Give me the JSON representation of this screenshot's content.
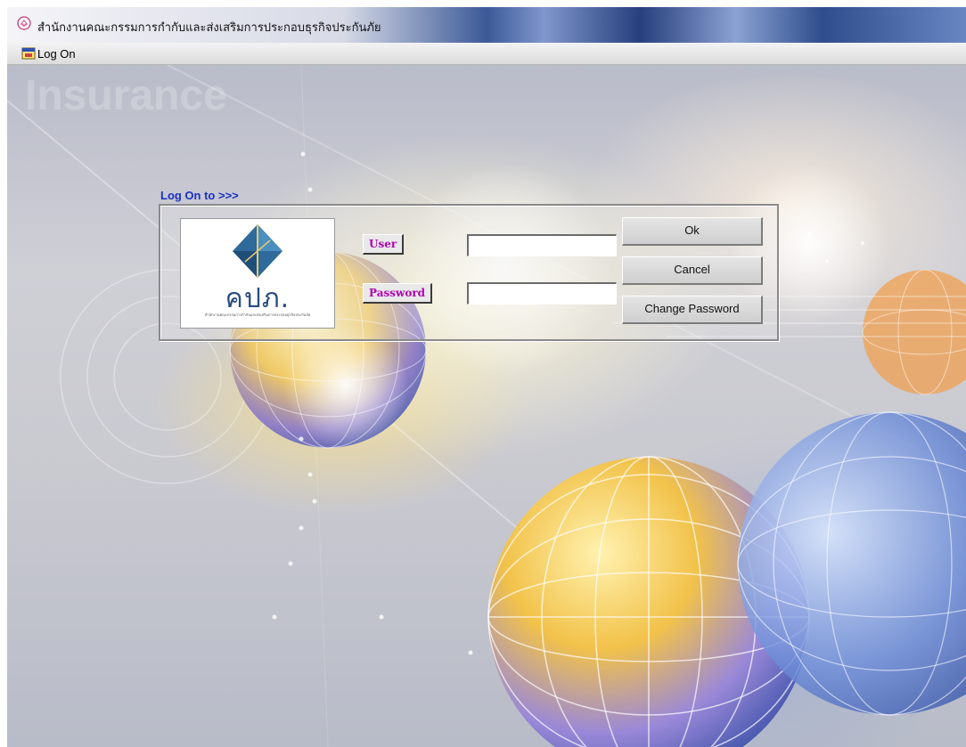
{
  "window": {
    "title": "สำนักงานคณะกรรมการกำกับและส่งเสริมการประกอบธุรกิจประกันภัย"
  },
  "child_window": {
    "title": "Log On"
  },
  "login": {
    "group_label": "Log On to >>>",
    "logo_text": "คปภ.",
    "logo_subtext": "สำนักงานคณะกรรมการกำกับและส่งเสริมการประกอบธุรกิจประกันภัย",
    "user_label": "User",
    "user_value": "",
    "password_label": "Password",
    "password_value": "",
    "ok_label": "Ok",
    "cancel_label": "Cancel",
    "change_password_label": "Change Password"
  },
  "icons": {
    "app_icon": "app-icon",
    "child_window_icon": "logon-window-icon",
    "logo_emblem": "diamond-emblem-icon"
  },
  "colors": {
    "group_label": "#1a2fc8",
    "field_label": "#b000b0",
    "logo_text": "#2b4c80"
  }
}
